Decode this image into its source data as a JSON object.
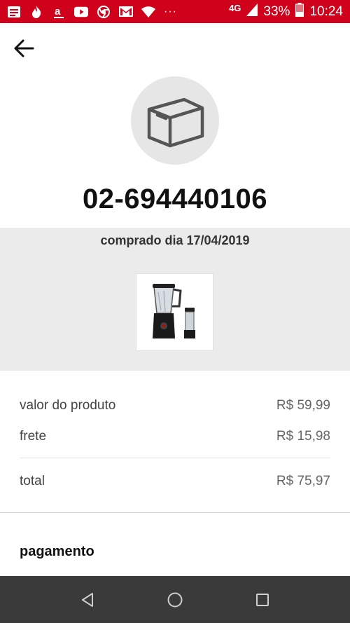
{
  "status_bar": {
    "network": "4G",
    "battery": "33%",
    "time": "10:24",
    "overflow": "···",
    "left_icons": [
      "notification-list-icon",
      "flame-icon",
      "a-app-icon",
      "youtube-icon",
      "chrome-icon",
      "gmail-icon",
      "wifi-icon"
    ]
  },
  "header": {
    "back_icon": "arrow-left-icon"
  },
  "order": {
    "icon": "package-box-icon",
    "number": "02-694440106",
    "purchased_on": "comprado dia 17/04/2019",
    "product_image": "blender-product-image"
  },
  "summary": {
    "rows": [
      {
        "label": "valor do produto",
        "value": "R$ 59,99"
      },
      {
        "label": "frete",
        "value": "R$ 15,98"
      }
    ],
    "total": {
      "label": "total",
      "value": "R$ 75,97"
    }
  },
  "payment": {
    "title": "pagamento"
  },
  "nav_bar": {
    "buttons": [
      "back-triangle-icon",
      "home-circle-icon",
      "recents-square-icon"
    ]
  },
  "colors": {
    "status_bar": "#d0021b",
    "nav_bar": "#3a3a3a",
    "panel": "#ebebeb",
    "icon_circle": "#e6e6e6"
  }
}
